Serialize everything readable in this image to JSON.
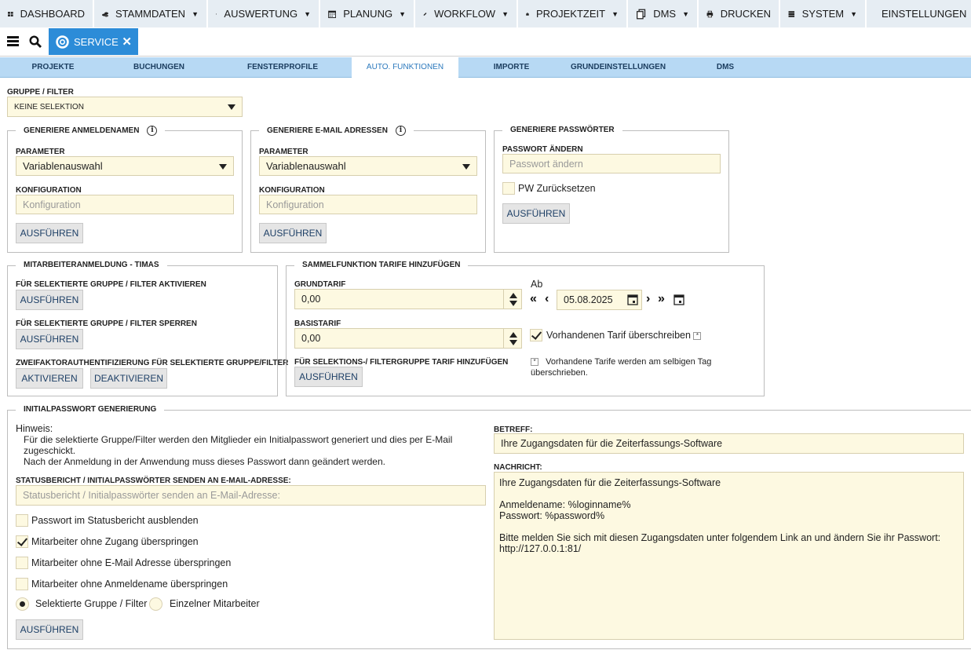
{
  "topnav": [
    {
      "label": "DASHBOARD",
      "icon": "dashboard-icon",
      "dropdown": false,
      "width": 120
    },
    {
      "label": "STAMMDATEN",
      "icon": "coins-icon",
      "dropdown": true,
      "width": 145
    },
    {
      "label": "AUSWERTUNG",
      "icon": "calendar-12-icon",
      "dropdown": true,
      "width": 143
    },
    {
      "label": "PLANUNG",
      "icon": "calendar-icon",
      "dropdown": true,
      "width": 121
    },
    {
      "label": "WORKFLOW",
      "icon": "pencil-icon",
      "dropdown": true,
      "width": 131
    },
    {
      "label": "PROJEKTZEIT",
      "icon": "briefcase-icon",
      "dropdown": true,
      "width": 140
    },
    {
      "label": "DMS",
      "icon": "documents-icon",
      "dropdown": true,
      "width": 90
    },
    {
      "label": "DRUCKEN",
      "icon": "printer-icon",
      "dropdown": false,
      "width": 104
    },
    {
      "label": "SYSTEM",
      "icon": "server-icon",
      "dropdown": true,
      "width": 110
    },
    {
      "label": "EINSTELLUNGEN",
      "icon": "gear-icon",
      "dropdown": false,
      "width": 133
    }
  ],
  "tab": {
    "label": "SERVICE",
    "icon": "lifebuoy-icon"
  },
  "subnav": [
    {
      "label": "PROJEKTE",
      "active": false
    },
    {
      "label": "BUCHUNGEN",
      "active": false
    },
    {
      "label": "FENSTERPROFILE",
      "active": false
    },
    {
      "label": "AUTO. FUNKTIONEN",
      "active": true
    },
    {
      "label": "IMPORTE",
      "active": false
    },
    {
      "label": "GRUNDEINSTELLUNGEN",
      "active": false
    },
    {
      "label": "DMS",
      "active": false
    }
  ],
  "gruppe_filter": {
    "label": "GRUPPE / FILTER",
    "value": "KEINE SELEKTION"
  },
  "anmeldenamen": {
    "legend": "GENERIERE ANMELDENAMEN",
    "param_label": "PARAMETER",
    "param_value": "Variablenauswahl",
    "konf_label": "KONFIGURATION",
    "konf_placeholder": "Konfiguration",
    "button": "AUSFÜHREN"
  },
  "email": {
    "legend": "GENERIERE E-MAIL ADRESSEN",
    "param_label": "PARAMETER",
    "param_value": "Variablenauswahl",
    "konf_label": "KONFIGURATION",
    "konf_placeholder": "Konfiguration",
    "button": "AUSFÜHREN"
  },
  "passwoerter": {
    "legend": "GENERIERE PASSWÖRTER",
    "pw_label": "PASSWORT ÄNDERN",
    "pw_placeholder": "Passwort ändern",
    "reset_label": "PW Zurücksetzen",
    "reset_checked": false,
    "button": "AUSFÜHREN"
  },
  "timas": {
    "legend": "MITARBEITERANMELDUNG - TIMAS",
    "activate_label": "FÜR SELEKTIERTE GRUPPE / FILTER AKTIVIEREN",
    "activate_button": "AUSFÜHREN",
    "lock_label": "FÜR SELEKTIERTE GRUPPE / FILTER SPERREN",
    "lock_button": "AUSFÜHREN",
    "twofa_label": "ZWEIFAKTORAUTHENTIFIZIERUNG FÜR SELEKTIERTE GRUPPE/FILTER",
    "twofa_activate": "AKTIVIEREN",
    "twofa_deactivate": "DEAKTIVIEREN"
  },
  "tarife": {
    "legend": "SAMMELFUNKTION TARIFE HINZUFÜGEN",
    "grund_label": "GRUNDTARIF",
    "grund_value": "0,00",
    "basis_label": "BASISTARIF",
    "basis_value": "0,00",
    "add_label": "FÜR SELEKTIONS-/ FILTERGRUPPE TARIF HINZUFÜGEN",
    "button": "AUSFÜHREN",
    "ab_label": "Ab",
    "date": "05.08.2025",
    "overwrite_label": "Vorhandenen Tarif überschreiben",
    "overwrite_checked": true,
    "note_line1": "Vorhandene Tarife werden am selbigen Tag",
    "note_line2": "überschrieben.",
    "aster": "*"
  },
  "initial": {
    "legend": "INITIALPASSWORT GENERIERUNG",
    "hinweis_title": "Hinweis:",
    "hinweis_line1": "Für die selektierte Gruppe/Filter werden den Mitglieder ein Initialpasswort generiert und dies per E-Mail",
    "hinweis_line2": "zugeschickt.",
    "hinweis_line3": "Nach der Anmeldung in der Anwendung muss dieses Passwort dann geändert werden.",
    "status_label": "STATUSBERICHT / INITIALPASSWÖRTER SENDEN AN E-MAIL-ADRESSE:",
    "status_placeholder": "Statusbericht / Initialpasswörter senden an E-Mail-Adresse:",
    "options": [
      {
        "label": "Passwort im Statusbericht ausblenden",
        "checked": false
      },
      {
        "label": "Mitarbeiter ohne Zugang überspringen",
        "checked": true
      },
      {
        "label": "Mitarbeiter ohne E-Mail Adresse überspringen",
        "checked": false
      },
      {
        "label": "Mitarbeiter ohne Anmeldename überspringen",
        "checked": false
      }
    ],
    "radio_group": "Selektierte Gruppe / Filter",
    "radio_single": "Einzelner Mitarbeiter",
    "radio_selected": "group",
    "button": "AUSFÜHREN",
    "betreff_label": "BETREFF:",
    "betreff_value": "Ihre Zugangsdaten für die Zeiterfassungs-Software",
    "nachricht_label": "NACHRICHT:",
    "nachricht_value": "Ihre Zugangsdaten für die Zeiterfassungs-Software\n\nAnmeldename: %loginname%\nPasswort: %password%\n\nBitte melden Sie sich mit diesen Zugangsdaten unter folgendem Link an und ändern Sie ihr Passwort:\nhttp://127.0.0.1:81/"
  }
}
